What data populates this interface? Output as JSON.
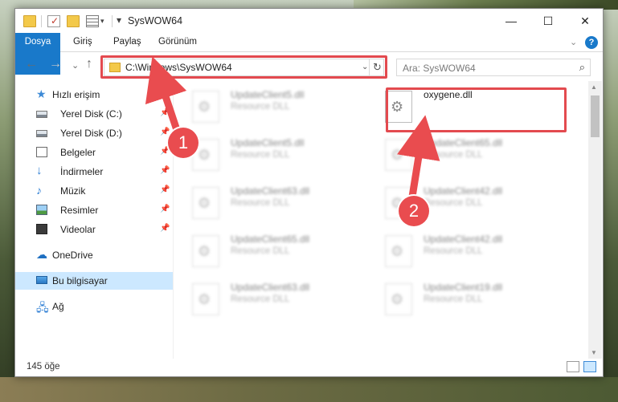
{
  "window": {
    "title": "SysWOW64",
    "min_glyph": "—",
    "max_glyph": "☐",
    "close_glyph": "✕"
  },
  "ribbon": {
    "tabs": [
      "Dosya",
      "Giriş",
      "Paylaş",
      "Görünüm"
    ],
    "collapse_glyph": "⌄",
    "help_glyph": "?"
  },
  "nav": {
    "back_glyph": "←",
    "forward_glyph": "→",
    "recent_glyph": "⌄",
    "up_glyph": "↑"
  },
  "address": {
    "path": "C:\\Windows\\SysWOW64",
    "dropdown_glyph": "⌄",
    "refresh_glyph": "↻"
  },
  "search": {
    "placeholder": "Ara: SysWOW64",
    "icon_glyph": "⌕"
  },
  "sidebar": {
    "items": [
      {
        "label": "Hızlı erişim",
        "icon": "star-icon",
        "pinned": false
      },
      {
        "label": "Yerel Disk (C:)",
        "icon": "drive-icon",
        "pinned": true
      },
      {
        "label": "Yerel Disk (D:)",
        "icon": "drive-icon",
        "pinned": true
      },
      {
        "label": "Belgeler",
        "icon": "documents-icon",
        "pinned": true
      },
      {
        "label": "İndirmeler",
        "icon": "downloads-icon",
        "pinned": true
      },
      {
        "label": "Müzik",
        "icon": "music-icon",
        "pinned": true
      },
      {
        "label": "Resimler",
        "icon": "pictures-icon",
        "pinned": true
      },
      {
        "label": "Videolar",
        "icon": "videos-icon",
        "pinned": true
      },
      {
        "label": "OneDrive",
        "icon": "onedrive-icon",
        "pinned": false
      },
      {
        "label": "Bu bilgisayar",
        "icon": "this-pc-icon",
        "pinned": false,
        "selected": true
      },
      {
        "label": "Ağ",
        "icon": "network-icon",
        "pinned": false
      }
    ],
    "pin_glyph": "📌"
  },
  "files": [
    {
      "name": "UpdateClient5.dll",
      "type": "Resource DLL"
    },
    {
      "name": "oxygene.dll",
      "type": ""
    },
    {
      "name": "UpdateClient5.dll",
      "type": "Resource DLL"
    },
    {
      "name": "UpdateClient65.dll",
      "type": "Resource DLL"
    },
    {
      "name": "UpdateClient63.dll",
      "type": "Resource DLL"
    },
    {
      "name": "UpdateClient42.dll",
      "type": "Resource DLL"
    },
    {
      "name": "UpdateClient65.dll",
      "type": "Resource DLL"
    },
    {
      "name": "UpdateClient42.dll",
      "type": "Resource DLL"
    },
    {
      "name": "UpdateClient63.dll",
      "type": "Resource DLL"
    },
    {
      "name": "UpdateClient19.dll",
      "type": "Resource DLL"
    }
  ],
  "status": {
    "count": "145 öğe"
  },
  "markers": [
    "1",
    "2"
  ],
  "colors": {
    "accent": "#1979ca",
    "highlight": "#e34a4f",
    "selection": "#cce8ff"
  }
}
